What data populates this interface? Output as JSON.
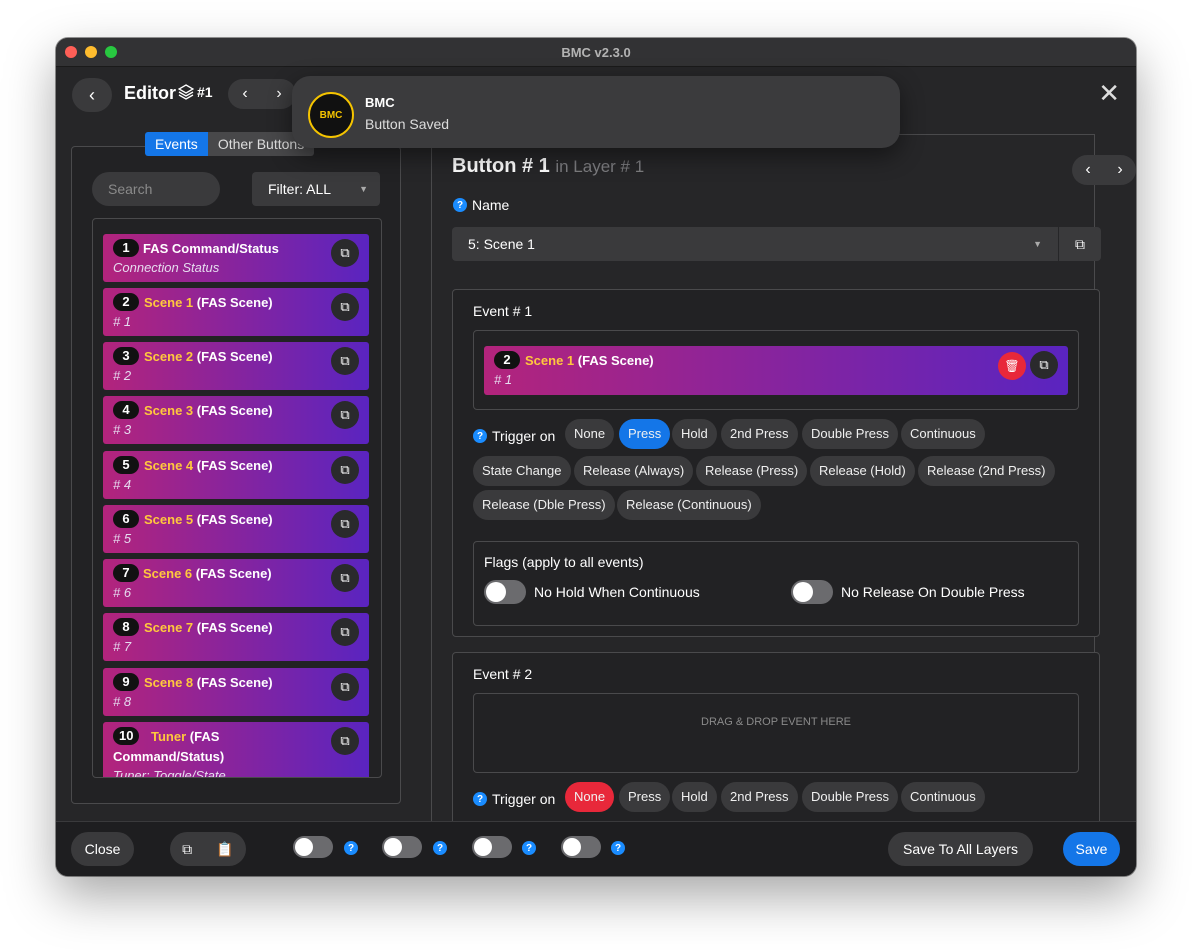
{
  "window": {
    "title": "BMC v2.3.0"
  },
  "header": {
    "title": "Editor",
    "layer": "#1"
  },
  "toast": {
    "app": "BMC",
    "message": "Button Saved",
    "logo_text": "BMC"
  },
  "left": {
    "tabs": [
      "Events",
      "Other Buttons"
    ],
    "search_placeholder": "Search",
    "filter_label": "Filter: ALL",
    "events": [
      {
        "num": "1",
        "highlight": "",
        "title": "FAS Command/Status",
        "subtitle": "Connection Status"
      },
      {
        "num": "2",
        "highlight": "Scene 1",
        "title": " (FAS Scene)",
        "subtitle": "# 1"
      },
      {
        "num": "3",
        "highlight": "Scene 2",
        "title": " (FAS Scene)",
        "subtitle": "# 2"
      },
      {
        "num": "4",
        "highlight": "Scene 3",
        "title": " (FAS Scene)",
        "subtitle": "# 3"
      },
      {
        "num": "5",
        "highlight": "Scene 4",
        "title": " (FAS Scene)",
        "subtitle": "# 4"
      },
      {
        "num": "6",
        "highlight": "Scene 5",
        "title": " (FAS Scene)",
        "subtitle": "# 5"
      },
      {
        "num": "7",
        "highlight": "Scene 6",
        "title": " (FAS Scene)",
        "subtitle": "# 6"
      },
      {
        "num": "8",
        "highlight": "Scene 7",
        "title": " (FAS Scene)",
        "subtitle": "# 7"
      },
      {
        "num": "9",
        "highlight": "Scene 8",
        "title": " (FAS Scene)",
        "subtitle": "# 8"
      },
      {
        "num": "10",
        "highlight": "Tuner",
        "title": " (FAS",
        "title2": "Command/Status)",
        "subtitle": "Tuner: Toggle/State"
      }
    ]
  },
  "right": {
    "title": "Button # 1",
    "subtitle": "in Layer # 1",
    "name_label": "Name",
    "name_value": "5: Scene 1",
    "event1": {
      "label": "Event # 1",
      "card": {
        "num": "2",
        "highlight": "Scene 1",
        "title": " (FAS Scene)",
        "subtitle": "# 1"
      },
      "trigger_label": "Trigger on",
      "triggers": [
        "None",
        "Press",
        "Hold",
        "2nd Press",
        "Double Press",
        "Continuous",
        "State Change",
        "Release (Always)",
        "Release (Press)",
        "Release (Hold)",
        "Release (2nd Press)",
        "Release (Dble Press)",
        "Release (Continuous)"
      ],
      "selected": "Press"
    },
    "flags": {
      "title": "Flags (apply to all events)",
      "flag1": "No Hold When Continuous",
      "flag2": "No Release On Double Press"
    },
    "event2": {
      "label": "Event # 2",
      "dropzone": "DRAG & DROP EVENT HERE",
      "trigger_label": "Trigger on",
      "triggers": [
        "None",
        "Press",
        "Hold",
        "2nd Press",
        "Double Press",
        "Continuous"
      ],
      "selected": "None"
    }
  },
  "footer": {
    "close": "Close",
    "save_all": "Save To All Layers",
    "save": "Save"
  },
  "colors": {
    "accent": "#1476e8",
    "danger": "#e8283a",
    "highlight": "#ffc83d"
  }
}
